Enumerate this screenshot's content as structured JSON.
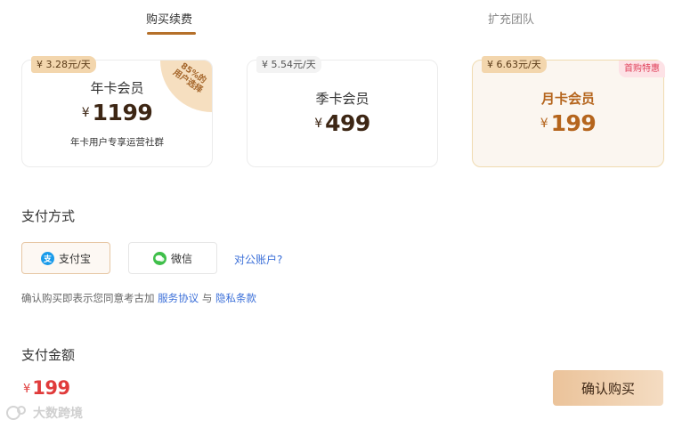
{
  "tabs": [
    {
      "label": "购买续费",
      "active": true
    },
    {
      "label": "扩充团队",
      "active": false
    }
  ],
  "plans": [
    {
      "price_tag": "¥ 3.28元/天",
      "name": "年卡会员",
      "currency": "¥",
      "price": "1199",
      "note": "年卡用户专享运营社群",
      "corner_badge": "85%的\n用户选择"
    },
    {
      "price_tag": "¥ 5.54元/天",
      "name": "季卡会员",
      "currency": "¥",
      "price": "499"
    },
    {
      "price_tag": "¥ 6.63元/天",
      "name": "月卡会员",
      "currency": "¥",
      "price": "199",
      "corner_badge": "首购特惠",
      "selected": true
    }
  ],
  "payment": {
    "title": "支付方式",
    "methods": [
      {
        "label": "支付宝",
        "icon": "alipay-icon",
        "selected": true
      },
      {
        "label": "微信",
        "icon": "wechat-icon",
        "selected": false
      }
    ],
    "corp_link": "对公账户?"
  },
  "agreement": {
    "prefix": "确认购买即表示您同意考古加",
    "service_link": "服务协议",
    "joiner": "与",
    "privacy_link": "隐私条款"
  },
  "amount": {
    "title": "支付金额",
    "currency": "¥",
    "value": "199"
  },
  "confirm_label": "确认购买",
  "watermark": "大数跨境",
  "colors": {
    "accent": "#b5702a",
    "price_red": "#e03b3b",
    "link": "#3b6fd8"
  }
}
